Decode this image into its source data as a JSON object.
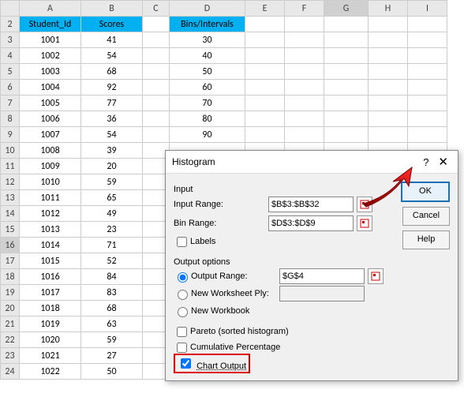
{
  "columns": [
    "A",
    "B",
    "C",
    "D",
    "E",
    "F",
    "G",
    "H",
    "I"
  ],
  "rows_start": 2,
  "rows_end": 24,
  "headers": {
    "A2": "Student_Id",
    "B2": "Scores",
    "D2": "Bins/Intervals"
  },
  "table": {
    "student_id": [
      1001,
      1002,
      1003,
      1004,
      1005,
      1006,
      1007,
      1008,
      1009,
      1010,
      1011,
      1012,
      1013,
      1014,
      1015,
      1016,
      1017,
      1018,
      1019,
      1020,
      1021,
      1022
    ],
    "scores": [
      41,
      54,
      68,
      92,
      77,
      36,
      54,
      39,
      20,
      59,
      65,
      49,
      23,
      71,
      52,
      84,
      83,
      68,
      63,
      59,
      27,
      50
    ]
  },
  "bins": [
    30,
    40,
    50,
    60,
    70,
    80,
    90
  ],
  "selected_row": 16,
  "selected_col": "G",
  "dialog": {
    "title": "Histogram",
    "input_label": "Input",
    "input_range_label": "Input Range:",
    "input_range": "$B$3:$B$32",
    "bin_range_label": "Bin Range:",
    "bin_range": "$D$3:$D$9",
    "labels_cb": "Labels",
    "output_label": "Output options",
    "output_range_label": "Output Range:",
    "output_range": "$G$4",
    "new_ws_label": "New Worksheet Ply:",
    "new_wb_label": "New Workbook",
    "pareto_label": "Pareto (sorted histogram)",
    "cumulative_label": "Cumulative Percentage",
    "chart_output_label": "Chart Output",
    "ok": "OK",
    "cancel": "Cancel",
    "help": "Help"
  }
}
